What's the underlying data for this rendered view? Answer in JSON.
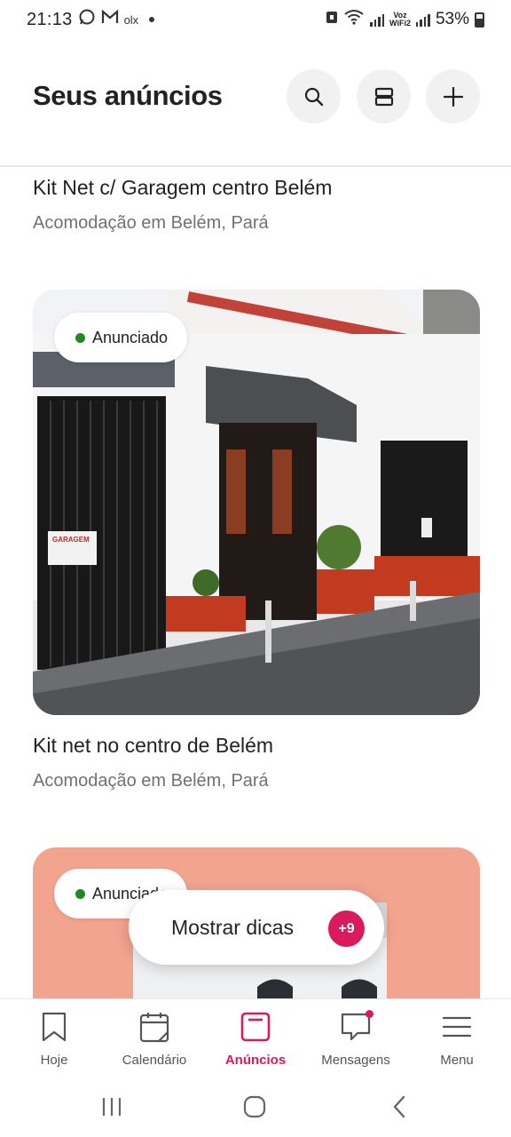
{
  "status_bar": {
    "time": "21:13",
    "notification_icons": [
      "whatsapp-icon",
      "gmail-icon",
      "olx-icon"
    ],
    "olx_label": "olx",
    "voz_label": "Voz",
    "wifi_label": "WiFi2",
    "battery": "53%"
  },
  "header": {
    "title": "Seus anúncios",
    "actions": [
      "search-icon",
      "layout-icon",
      "plus-icon"
    ]
  },
  "listings": [
    {
      "title": "Kit Net c/ Garagem centro  Belém",
      "subtitle": "Acomodação em Belém, Pará"
    },
    {
      "status": "Anunciado",
      "title": "Kit net no centro de Belém",
      "subtitle": "Acomodação em Belém, Pará",
      "sign_text": "GARAGEM"
    },
    {
      "status": "Anunciado"
    }
  ],
  "tips": {
    "label": "Mostrar dicas",
    "count": "+9"
  },
  "bottom_nav": {
    "items": [
      {
        "label": "Hoje",
        "icon": "bookmark-icon"
      },
      {
        "label": "Calendário",
        "icon": "calendar-icon"
      },
      {
        "label": "Anúncios",
        "icon": "listings-icon",
        "active": true
      },
      {
        "label": "Mensagens",
        "icon": "message-icon",
        "has_badge": true
      },
      {
        "label": "Menu",
        "icon": "menu-icon"
      }
    ]
  },
  "colors": {
    "accent": "#d91a5c",
    "listed_dot": "#1f8a1f",
    "card_peach": "#f2a48f"
  }
}
